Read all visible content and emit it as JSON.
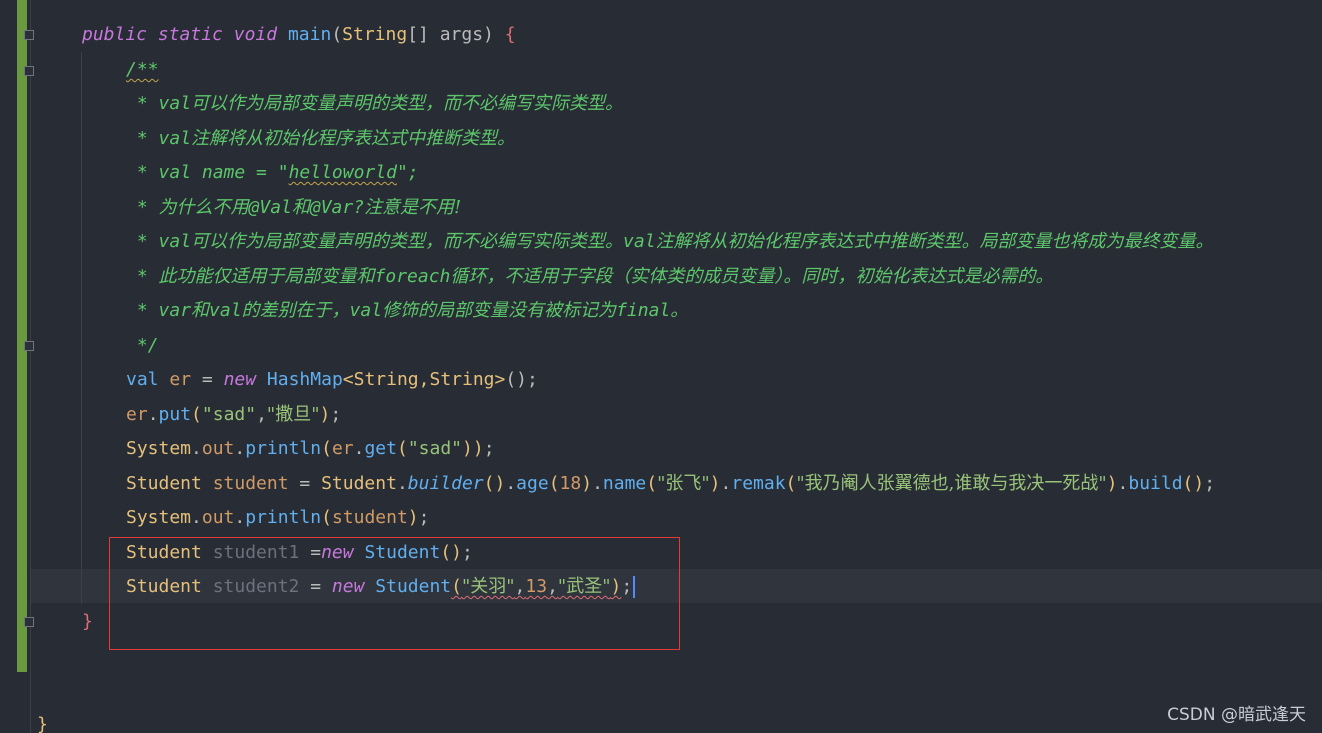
{
  "code": {
    "kw_public": "public",
    "kw_static": "static",
    "kw_void": "void",
    "fn_main": "main",
    "type_string": "String",
    "sig_rest": "[] args)",
    "open_brace": "{",
    "doc_open": "/**",
    "doc_star": " * ",
    "doc_close": " */",
    "doc_l1_val": "val",
    "doc_l1_text": "可以作为局部变量声明的类型，而不必编写实际类型。",
    "doc_l2_val": "val",
    "doc_l2_text": "注解将从初始化程序表达式中推断类型。",
    "doc_l3_pre": "val name = ",
    "doc_l3_q1": "\"",
    "doc_l3_word": "helloworld",
    "doc_l3_post": "\";",
    "doc_l4_a": "为什么不用",
    "doc_l4_b": "@Val",
    "doc_l4_c": "和",
    "doc_l4_d": "@Var?",
    "doc_l4_e": "注意是不用!",
    "doc_l5_a": "val",
    "doc_l5_b": "可以作为局部变量声明的类型，而不必编写实际类型。",
    "doc_l5_c": "val",
    "doc_l5_d": "注解将从初始化程序表达式中推断类型。局部变量也将成为最终变量。",
    "doc_l6_a": "此功能仅适用于局部变量和",
    "doc_l6_b": "foreach",
    "doc_l6_c": "循环，不适用于字段（实体类的成员变量）。同时，初始化表达式是必需的。",
    "doc_l7_a": "var",
    "doc_l7_b": "和",
    "doc_l7_c": "val",
    "doc_l7_d": "的差别在于，",
    "doc_l7_e": "val",
    "doc_l7_f": "修饰的局部变量没有被标记为",
    "doc_l7_g": "final",
    "doc_l7_h": "。",
    "l_val": "val",
    "l_er": "er",
    "l_eq": " = ",
    "l_new": "new",
    "l_hashmap": "HashMap",
    "l_generic": "<String,String>",
    "l_parens_semi": "();",
    "l_put": "put",
    "s_sad": "\"sad\"",
    "s_satan": "\"撒旦\"",
    "comma": ",",
    "l_system": "System",
    "l_out": "out",
    "l_println": "println",
    "l_get": "get",
    "l_student_type": "Student",
    "l_student_var": "student",
    "l_builder": "builder",
    "l_age": "age",
    "n_18": "18",
    "l_name": "name",
    "s_zhangfei": "\"张飞\"",
    "l_remak": "remak",
    "s_quote": "\"我乃阉人张翼德也,谁敢与我决一死战\"",
    "l_build": "build",
    "l_student1": "student1",
    "eq_new": " =",
    "l_student2": "student2",
    "s_guanyu": "\"关羽\"",
    "n_13": "13",
    "s_wusheng": "\"武圣\"",
    "close_brace": "}",
    "outer_close": "}"
  },
  "watermark": "CSDN @暗武逢天",
  "colors": {
    "background": "#282c34",
    "keyword": "#c678dd",
    "function": "#61afef",
    "type": "#e5c07b",
    "string": "#98c379",
    "number": "#d19a66",
    "doc_comment": "#5cc66a",
    "highlight_box": "#e53935",
    "change_bar": "#6a9a3f"
  }
}
